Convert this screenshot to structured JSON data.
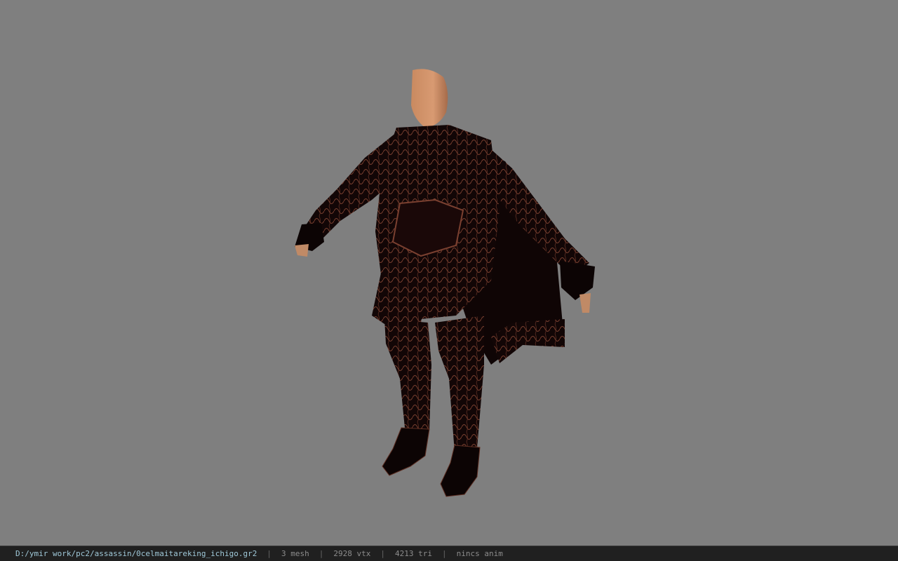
{
  "viewer": {
    "background_color": "#7f7f7f",
    "model_icon": "armored-character-model"
  },
  "status": {
    "file_path": "D:/ymir work/pc2/assassin/0celmaitareking_ichigo.gr2",
    "separator": "|",
    "mesh": "3 mesh",
    "vertices": "2928 vtx",
    "triangles": "4213 tri",
    "animation": "nincs anim"
  }
}
